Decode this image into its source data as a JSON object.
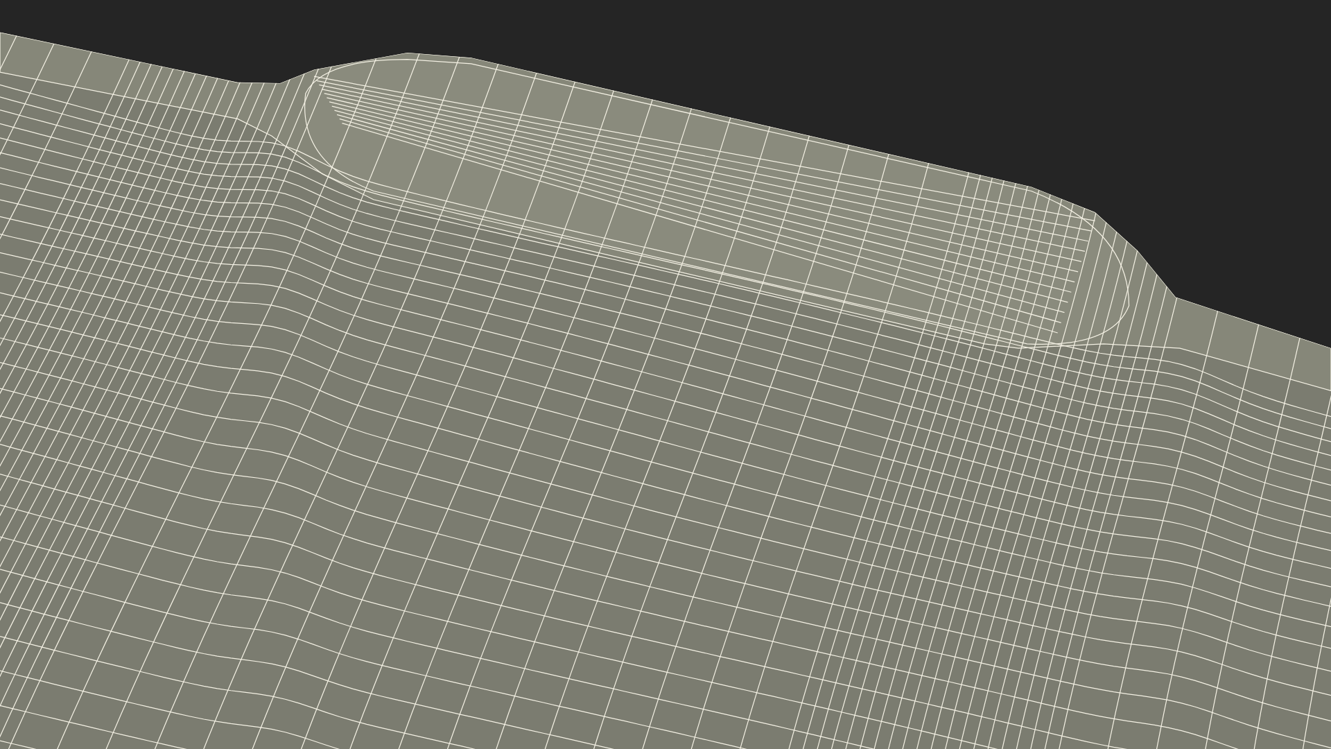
{
  "viewport": {
    "kind": "wireframe"
  }
}
